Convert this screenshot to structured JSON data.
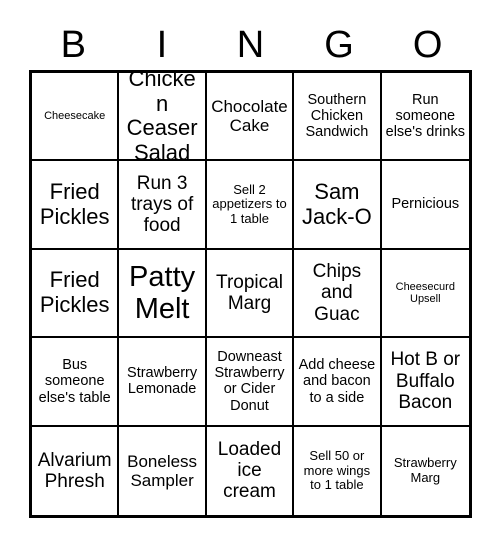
{
  "card": {
    "title_letters": [
      "B",
      "I",
      "N",
      "G",
      "O"
    ],
    "columns": 5,
    "rows": 5,
    "colors": {
      "background": "#ffffff",
      "text": "#000000",
      "grid_line": "#000000"
    },
    "cells": [
      {
        "text": "Cheesecake",
        "size": "fs-xs"
      },
      {
        "text": "Chicken Ceaser Salad",
        "size": "fs-2xl"
      },
      {
        "text": "Chocolate Cake",
        "size": "fs-lg"
      },
      {
        "text": "Southern Chicken Sandwich",
        "size": "fs-md"
      },
      {
        "text": "Run someone else's drinks",
        "size": "fs-md"
      },
      {
        "text": "Fried Pickles",
        "size": "fs-2xl"
      },
      {
        "text": "Run 3 trays of food",
        "size": "fs-xl"
      },
      {
        "text": "Sell 2 appetizers to 1 table",
        "size": "fs-sm"
      },
      {
        "text": "Sam Jack-O",
        "size": "fs-2xl"
      },
      {
        "text": "Pernicious",
        "size": "fs-md"
      },
      {
        "text": "Fried Pickles",
        "size": "fs-2xl"
      },
      {
        "text": "Patty Melt",
        "size": "fs-3xl"
      },
      {
        "text": "Tropical Marg",
        "size": "fs-xl"
      },
      {
        "text": "Chips and Guac",
        "size": "fs-xl"
      },
      {
        "text": "Cheesecurd Upsell",
        "size": "fs-xs"
      },
      {
        "text": "Bus someone else's table",
        "size": "fs-md"
      },
      {
        "text": "Strawberry Lemonade",
        "size": "fs-md"
      },
      {
        "text": "Downeast Strawberry or Cider Donut",
        "size": "fs-md"
      },
      {
        "text": "Add cheese and bacon to a side",
        "size": "fs-md"
      },
      {
        "text": "Hot B or Buffalo Bacon",
        "size": "fs-xl"
      },
      {
        "text": "Alvarium Phresh",
        "size": "fs-xl"
      },
      {
        "text": "Boneless Sampler",
        "size": "fs-lg"
      },
      {
        "text": "Loaded ice cream",
        "size": "fs-xl"
      },
      {
        "text": "Sell 50 or more wings to 1 table",
        "size": "fs-sm"
      },
      {
        "text": "Strawberry Marg",
        "size": "fs-sm"
      }
    ]
  }
}
